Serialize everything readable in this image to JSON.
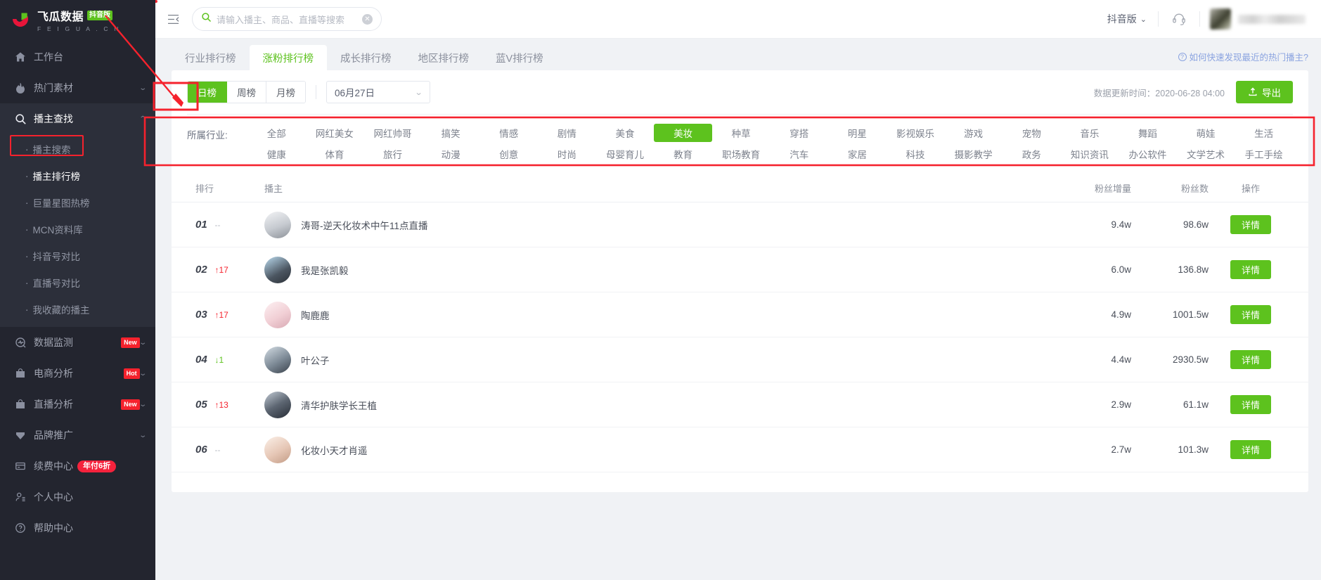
{
  "brand": {
    "name_cn": "飞瓜数据",
    "badge": "抖音版",
    "name_en": "F E I G U A . C N",
    "accent": "#5dc21e",
    "sidebar_bg": "#23252f"
  },
  "sidebar": {
    "items": [
      {
        "label": "工作台",
        "icon": "home-icon",
        "expandable": false
      },
      {
        "label": "热门素材",
        "icon": "fire-icon",
        "expandable": true
      },
      {
        "label": "播主查找",
        "icon": "search-icon",
        "expandable": true,
        "active": true
      }
    ],
    "sub_items": [
      {
        "label": "播主搜索"
      },
      {
        "label": "播主排行榜",
        "selected": true
      },
      {
        "label": "巨量星图热榜"
      },
      {
        "label": "MCN资料库"
      },
      {
        "label": "抖音号对比"
      },
      {
        "label": "直播号对比"
      },
      {
        "label": "我收藏的播主"
      }
    ],
    "items_bottom": [
      {
        "label": "数据监测",
        "icon": "monitor-icon",
        "badge": "New",
        "expandable": true
      },
      {
        "label": "电商分析",
        "icon": "bag-icon",
        "badge": "Hot",
        "expandable": true
      },
      {
        "label": "直播分析",
        "icon": "bag-icon",
        "badge": "New",
        "expandable": true
      },
      {
        "label": "品牌推广",
        "icon": "diamond-icon",
        "badge": "",
        "expandable": true
      },
      {
        "label": "续费中心",
        "icon": "card-icon",
        "badge": "年付6折",
        "expandable": false
      },
      {
        "label": "个人中心",
        "icon": "user-icon",
        "badge": "",
        "expandable": false
      },
      {
        "label": "帮助中心",
        "icon": "question-icon",
        "badge": "",
        "expandable": false
      }
    ]
  },
  "topbar": {
    "collapse_icon": "collapse-menu-icon",
    "search": {
      "placeholder": "请输入播主、商品、直播等搜索",
      "value": "",
      "clear": "✕"
    },
    "version": "抖音版",
    "service_icon": "headset-icon"
  },
  "tabs": [
    {
      "label": "行业排行榜",
      "active": false
    },
    {
      "label": "涨粉排行榜",
      "active": true
    },
    {
      "label": "成长排行榜",
      "active": false
    },
    {
      "label": "地区排行榜",
      "active": false
    },
    {
      "label": "蓝V排行榜",
      "active": false
    }
  ],
  "help_link": "如何快速发现最近的热门播主?",
  "controls": {
    "period": [
      {
        "label": "日榜",
        "on": true
      },
      {
        "label": "周榜",
        "on": false
      },
      {
        "label": "月榜",
        "on": false
      }
    ],
    "date": "06月27日",
    "update_time": "数据更新时间：2020-06-28 04:00",
    "export": "导出"
  },
  "industry": {
    "label": "所属行业:",
    "row1": [
      "全部",
      "网红美女",
      "网红帅哥",
      "搞笑",
      "情感",
      "剧情",
      "美食",
      "美妆",
      "种草",
      "穿搭",
      "明星",
      "影视娱乐",
      "游戏",
      "宠物",
      "音乐",
      "舞蹈",
      "萌娃",
      "生活"
    ],
    "row2": [
      "健康",
      "体育",
      "旅行",
      "动漫",
      "创意",
      "时尚",
      "母婴育儿",
      "教育",
      "职场教育",
      "汽车",
      "家居",
      "科技",
      "摄影教学",
      "政务",
      "知识资讯",
      "办公软件",
      "文学艺术",
      "手工手绘"
    ],
    "selected": "美妆"
  },
  "table": {
    "headers": {
      "rank": "排行",
      "host": "播主",
      "increase": "粉丝增量",
      "fans": "粉丝数",
      "op": "操作"
    },
    "detail_label": "详情",
    "rows": [
      {
        "rank": "01",
        "delta": "--",
        "dir": "flat",
        "name": "涛哥-逆天化妆术中午11点直播",
        "increase": "9.4w",
        "fans": "98.6w",
        "avatar": "#cfd3d8"
      },
      {
        "rank": "02",
        "delta": "↑17",
        "dir": "up",
        "name": "我是张凯毅",
        "increase": "6.0w",
        "fans": "136.8w",
        "avatar": "#9ec6e0"
      },
      {
        "rank": "03",
        "delta": "↑17",
        "dir": "up",
        "name": "陶鹿鹿",
        "increase": "4.9w",
        "fans": "1001.5w",
        "avatar": "#f0d8dc"
      },
      {
        "rank": "04",
        "delta": "↓1",
        "dir": "down",
        "name": "叶公子",
        "increase": "4.4w",
        "fans": "2930.5w",
        "avatar": "#b7c3cc"
      },
      {
        "rank": "05",
        "delta": "↑13",
        "dir": "up",
        "name": "清华护肤学长王植",
        "increase": "2.9w",
        "fans": "61.1w",
        "avatar": "#8f9aa6"
      },
      {
        "rank": "06",
        "delta": "--",
        "dir": "flat",
        "name": "化妆小天才肖遥",
        "increase": "2.7w",
        "fans": "101.3w",
        "avatar": "#e8cfc4"
      }
    ]
  }
}
